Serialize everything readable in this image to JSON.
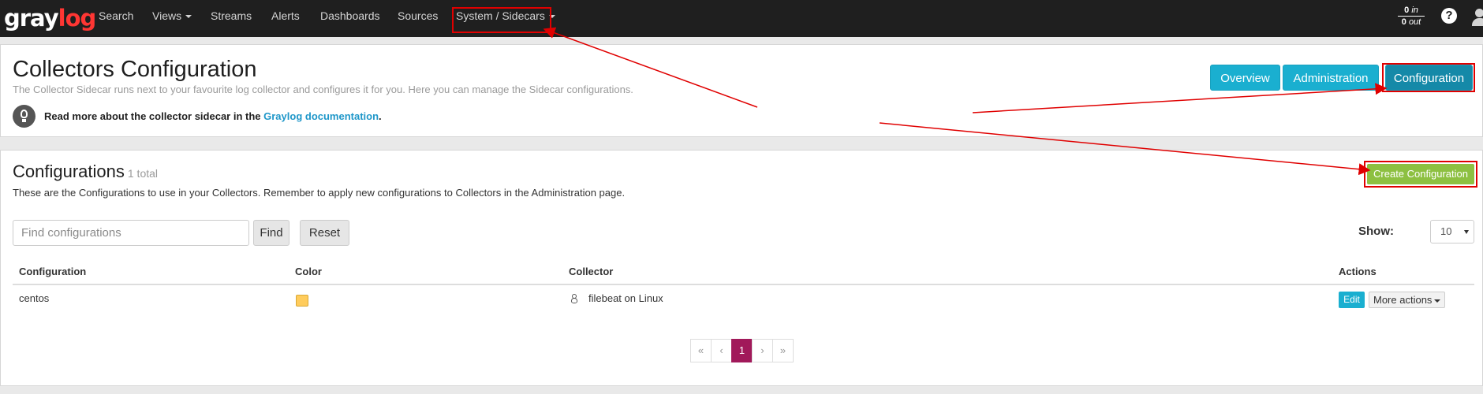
{
  "nav": {
    "logo_a": "gray",
    "logo_b": "log",
    "items": [
      {
        "label": "Search"
      },
      {
        "label": "Views"
      },
      {
        "label": "Streams"
      },
      {
        "label": "Alerts"
      },
      {
        "label": "Dashboards"
      },
      {
        "label": "Sources"
      },
      {
        "label": "System / Sidecars"
      }
    ],
    "throughput": {
      "in_value": "0",
      "in_label": "in",
      "out_value": "0",
      "out_label": "out"
    },
    "help_glyph": "?"
  },
  "header": {
    "title": "Collectors Configuration",
    "description": "The Collector Sidecar runs next to your favourite log collector and configures it for you. Here you can manage the Sidecar configurations.",
    "read_more_prefix": "Read more about the collector sidecar in the",
    "read_more_link": "Graylog documentation",
    "read_more_suffix": ".",
    "buttons": {
      "overview": "Overview",
      "administration": "Administration",
      "configuration": "Configuration"
    }
  },
  "configurations": {
    "title": "Configurations",
    "count": "1 total",
    "description": "These are the Configurations to use in your Collectors. Remember to apply new configurations to Collectors in the Administration page.",
    "create_button": "Create Configuration",
    "search_placeholder": "Find configurations",
    "find_button": "Find",
    "reset_button": "Reset",
    "show_label": "Show:",
    "show_value": "10",
    "columns": {
      "configuration": "Configuration",
      "color": "Color",
      "collector": "Collector",
      "actions": "Actions"
    },
    "rows": [
      {
        "name": "centos",
        "color": "#ffcc5c",
        "collector": "filebeat on Linux",
        "os_icon": "linux-icon",
        "edit": "Edit",
        "more": "More actions"
      }
    ],
    "pagination": {
      "first": "«",
      "prev": "‹",
      "current": "1",
      "next": "›",
      "last": "»"
    }
  }
}
